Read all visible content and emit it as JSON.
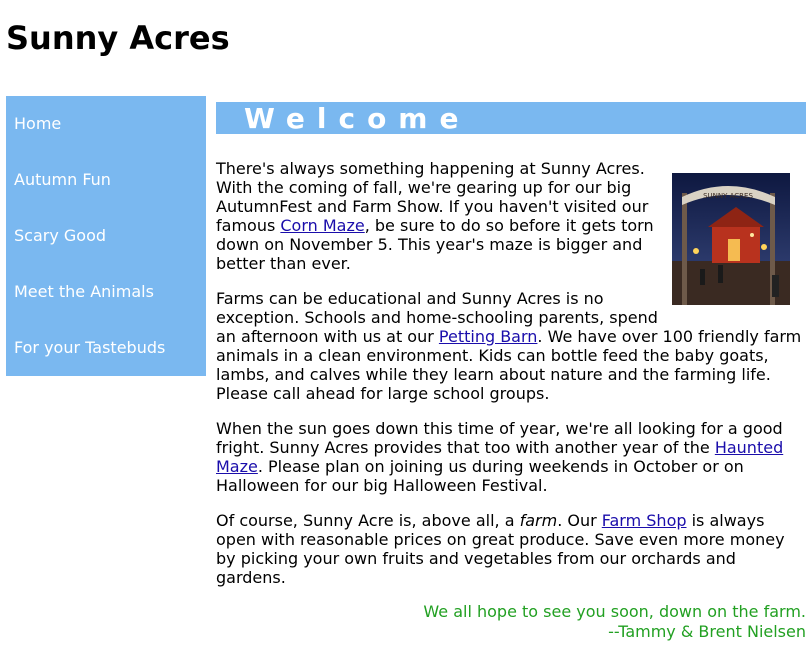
{
  "site": {
    "title": "Sunny Acres"
  },
  "nav": {
    "items": [
      {
        "label": "Home"
      },
      {
        "label": "Autumn Fun"
      },
      {
        "label": "Scary Good"
      },
      {
        "label": "Meet the Animals"
      },
      {
        "label": "For your Tastebuds"
      }
    ]
  },
  "banner": {
    "heading": "Welcome"
  },
  "content": {
    "p1": {
      "before": "There's always something happening at Sunny Acres. With the coming of fall, we're gearing up for our big AutumnFest and Farm Show. If you haven't visited our famous ",
      "link": "Corn Maze",
      "after": ", be sure to do so before it gets torn down on November 5. This year's maze is bigger and better than ever."
    },
    "p2": {
      "before": "Farms can be educational and Sunny Acres is no exception. Schools and home-schooling parents, spend an afternoon with us at our ",
      "link": "Petting Barn",
      "after": ". We have over 100 friendly farm animals in a clean environment. Kids can bottle feed the baby goats, lambs, and calves while they learn about nature and the farming life. Please call ahead for large school groups."
    },
    "p3": {
      "before": "When the sun goes down this time of year, we're all looking for a good fright. Sunny Acres provides that too with another year of the ",
      "link": "Haunted Maze",
      "after": ". Please plan on joining us during weekends in October or on Halloween for our big Halloween Festival."
    },
    "p4": {
      "before": "Of course, Sunny Acre is, above all, a ",
      "emphasis": "farm",
      "middle": ". Our ",
      "link": "Farm Shop",
      "after": " is always open with reasonable prices on great produce. Save even more money by picking your own fruits and vegetables from our orchards and gardens."
    }
  },
  "signoff": {
    "line1": "We all hope to see you soon, down on the farm.",
    "line2": "--Tammy & Brent Nielsen"
  },
  "photo": {
    "sign_text": "SUNNY ACRES",
    "sky_color": "#1c2a55",
    "barn_color": "#b8321e",
    "light_color": "#ffd45a"
  },
  "colors": {
    "accent": "#7ab8f0",
    "link": "#1a0dab",
    "signoff": "#22a022"
  }
}
